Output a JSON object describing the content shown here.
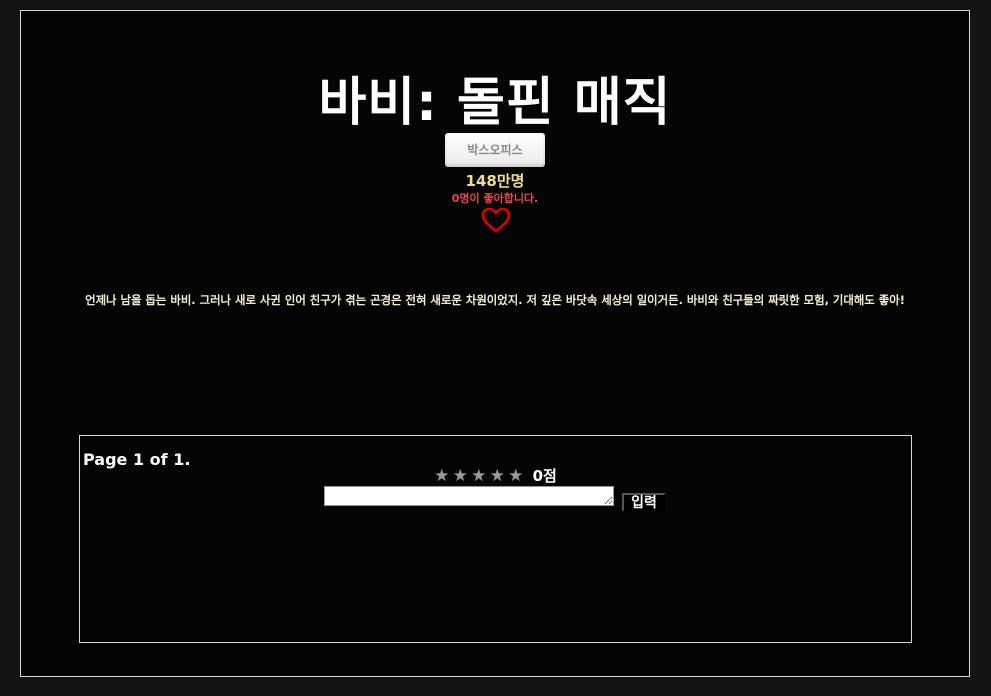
{
  "movie": {
    "title": "바비: 돌핀 매직",
    "category_label": "박스오피스",
    "audience": "148만명",
    "likes_text": "0명이 좋아합니다.",
    "description": "언제나 남을 돕는 바비. 그러나 새로 사귄 인어 친구가 겪는 곤경은 전혀 새로운 차원이었지. 저 깊은 바닷속 세상의 일이거든. 바비와 친구들의 짜릿한 모험, 기대해도 좋아!"
  },
  "review": {
    "page_info": "Page 1 of 1.",
    "stars": [
      "★",
      "★",
      "★",
      "★",
      "★"
    ],
    "rating_level": 0,
    "score_text": "0점",
    "input_value": "",
    "submit_label": "입력"
  },
  "icons": {
    "heart": "heart-outline-icon",
    "star": "star-icon"
  },
  "colors": {
    "background": "#050505",
    "heart": "#e00000",
    "audience": "#f0e08a",
    "likes": "#e84a4a",
    "star_inactive": "#9a9a9a"
  }
}
